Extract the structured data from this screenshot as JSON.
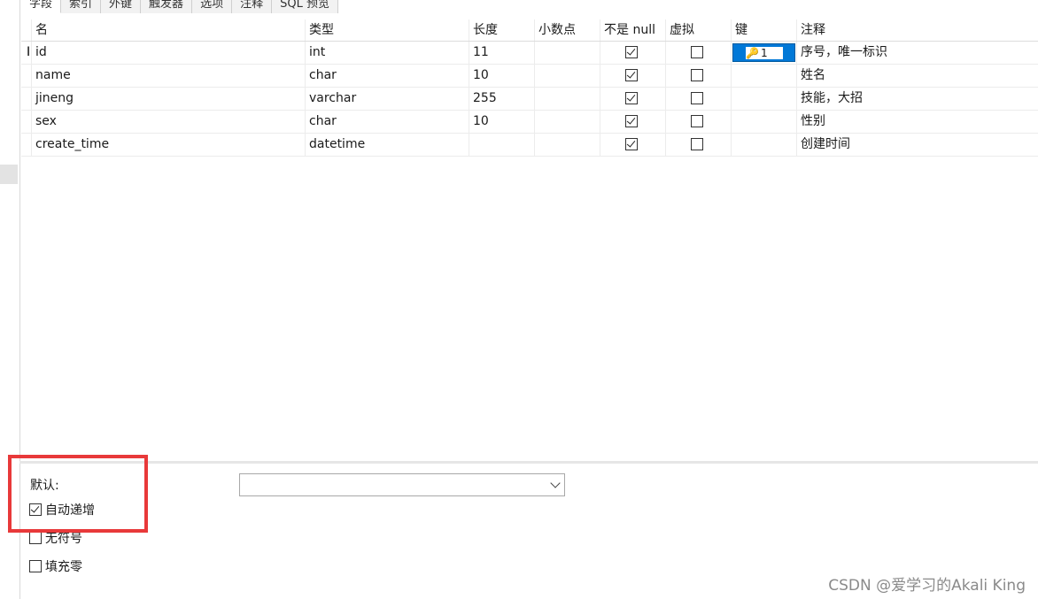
{
  "tabs": [
    "字段",
    "索引",
    "外键",
    "触发器",
    "选项",
    "注释",
    "SQL 预览"
  ],
  "columns": [
    "名",
    "类型",
    "长度",
    "小数点",
    "不是 null",
    "虚拟",
    "键",
    "注释"
  ],
  "rows": [
    {
      "name": "id",
      "type": "int",
      "length": "11",
      "decimal": "",
      "not_null": true,
      "virtual": false,
      "key": "1",
      "comment": "序号，唯一标识"
    },
    {
      "name": "name",
      "type": "char",
      "length": "10",
      "decimal": "",
      "not_null": true,
      "virtual": false,
      "key": "",
      "comment": "姓名"
    },
    {
      "name": "jineng",
      "type": "varchar",
      "length": "255",
      "decimal": "",
      "not_null": true,
      "virtual": false,
      "key": "",
      "comment": "技能，大招"
    },
    {
      "name": "sex",
      "type": "char",
      "length": "10",
      "decimal": "",
      "not_null": true,
      "virtual": false,
      "key": "",
      "comment": "性别"
    },
    {
      "name": "create_time",
      "type": "datetime",
      "length": "",
      "decimal": "",
      "not_null": true,
      "virtual": false,
      "key": "",
      "comment": "创建时间"
    }
  ],
  "cursor_glyph": "I",
  "key_icon": "key-icon",
  "bottom": {
    "default_label": "默认:",
    "default_value": "",
    "options": [
      {
        "label": "自动递增",
        "checked": true
      },
      {
        "label": "无符号",
        "checked": false
      },
      {
        "label": "填充零",
        "checked": false
      }
    ]
  },
  "watermark": "CSDN @爱学习的Akali King",
  "colors": {
    "highlight": "#e8393a",
    "selection": "#0078d7",
    "key": "#d8a000"
  }
}
